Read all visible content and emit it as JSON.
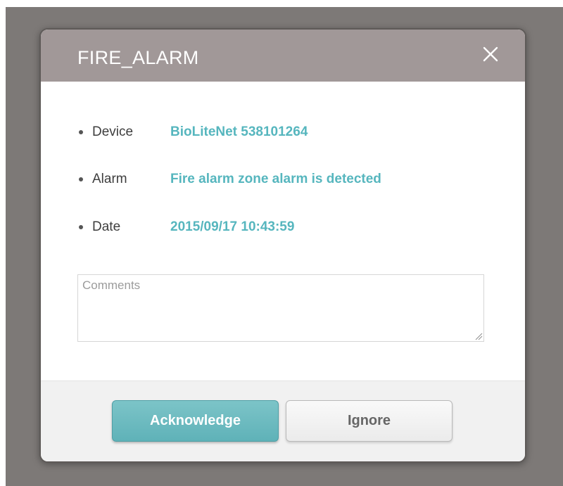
{
  "dialog": {
    "title": "FIRE_ALARM",
    "close_icon": "close-icon"
  },
  "details": [
    {
      "label": "Device",
      "value": "BioLiteNet 538101264"
    },
    {
      "label": "Alarm",
      "value": "Fire alarm zone alarm is detected"
    },
    {
      "label": "Date",
      "value": "2015/09/17 10:43:59"
    }
  ],
  "comments": {
    "placeholder": "Comments",
    "value": ""
  },
  "buttons": {
    "acknowledge": "Acknowledge",
    "ignore": "Ignore"
  },
  "colors": {
    "header_bg": "#a19898",
    "value_text": "#56b6be",
    "accent_button": "#6bbcc1",
    "backdrop": "#7d7977"
  }
}
